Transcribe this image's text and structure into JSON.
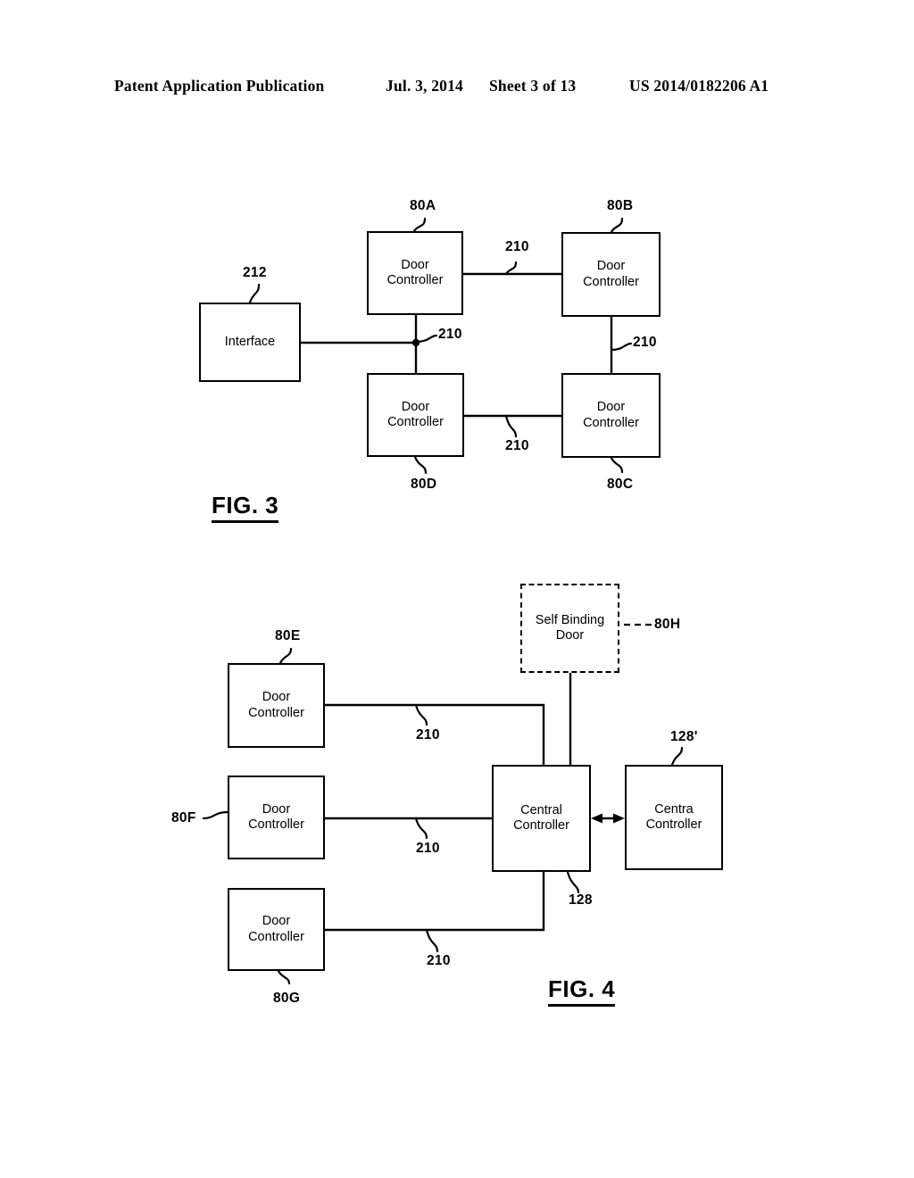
{
  "header": {
    "publication": "Patent Application Publication",
    "date": "Jul. 3, 2014",
    "sheet": "Sheet 3 of 13",
    "number": "US 2014/0182206 A1"
  },
  "figures": [
    {
      "caption": "FIG. 3",
      "boxes": [
        {
          "name": "interface-box",
          "label": "Interface",
          "ref": "212"
        },
        {
          "name": "door-controller-80a-box",
          "label": "Door\nController",
          "ref": "80A"
        },
        {
          "name": "door-controller-80b-box",
          "label": "Door\nController",
          "ref": "80B"
        },
        {
          "name": "door-controller-80c-box",
          "label": "Door\nController",
          "ref": "80C"
        },
        {
          "name": "door-controller-80d-box",
          "label": "Door\nController",
          "ref": "80D"
        }
      ],
      "link_refs": [
        "210",
        "210",
        "210",
        "210"
      ]
    },
    {
      "caption": "FIG. 4",
      "boxes": [
        {
          "name": "door-controller-80e-box",
          "label": "Door\nController",
          "ref": "80E"
        },
        {
          "name": "door-controller-80f-box",
          "label": "Door\nController",
          "ref": "80F"
        },
        {
          "name": "door-controller-80g-box",
          "label": "Door\nController",
          "ref": "80G"
        },
        {
          "name": "self-binding-door-box",
          "label": "Self Binding\nDoor",
          "ref": "80H"
        },
        {
          "name": "central-controller-box",
          "label": "Central\nController",
          "ref": "128"
        },
        {
          "name": "centra-controller-box",
          "label": "Centra\nController",
          "ref": "128'"
        }
      ],
      "link_refs": [
        "210",
        "210",
        "210"
      ]
    }
  ],
  "fig3": {
    "caption": "FIG. 3",
    "interface_label": "Interface",
    "interface_ref": "212",
    "dc_a_label": "Door\nController",
    "dc_a_ref": "80A",
    "dc_b_label": "Door\nController",
    "dc_b_ref": "80B",
    "dc_c_label": "Door\nController",
    "dc_c_ref": "80C",
    "dc_d_label": "Door\nController",
    "dc_d_ref": "80D",
    "link_ab_ref": "210",
    "link_ad_ref": "210",
    "link_bc_ref": "210",
    "link_dc_ref": "210"
  },
  "fig4": {
    "caption": "FIG. 4",
    "dc_e_label": "Door\nController",
    "dc_e_ref": "80E",
    "dc_f_label": "Door\nController",
    "dc_f_ref": "80F",
    "dc_g_label": "Door\nController",
    "dc_g_ref": "80G",
    "self_binding_door_label": "Self Binding\nDoor",
    "self_binding_door_ref": "80H",
    "central_controller_label": "Central\nController",
    "central_controller_ref": "128",
    "centra_controller_label": "Centra\nController",
    "centra_controller_ref": "128'",
    "link_e_ref": "210",
    "link_f_ref": "210",
    "link_g_ref": "210"
  },
  "colors": {
    "ink": "#000000",
    "paper": "#ffffff"
  }
}
